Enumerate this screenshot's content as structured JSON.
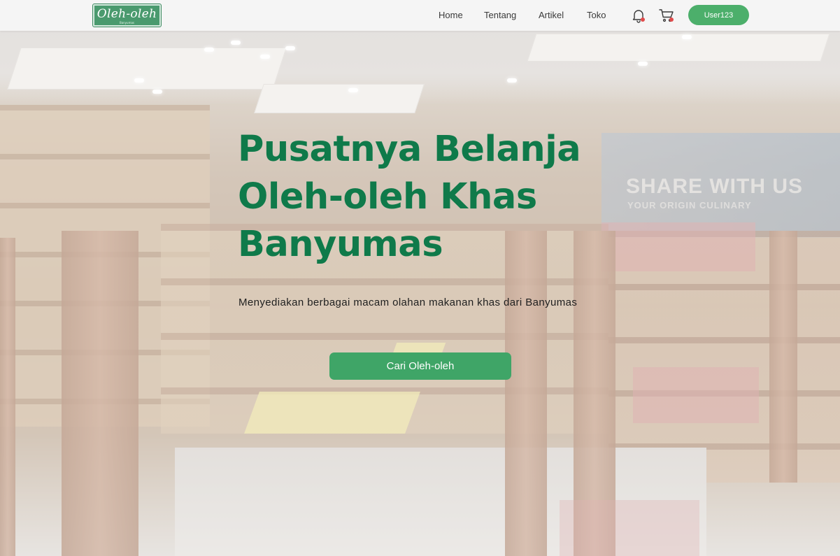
{
  "brand": {
    "logo_text": "Oleh-oleh",
    "logo_subtext": "Banyumas"
  },
  "nav": {
    "links": [
      {
        "label": "Home"
      },
      {
        "label": "Tentang"
      },
      {
        "label": "Artikel"
      },
      {
        "label": "Toko"
      }
    ],
    "notification_icon": "bell-icon",
    "cart_icon": "cart-icon",
    "user_label": "User123"
  },
  "hero": {
    "title_lines": [
      "Pusatnya Belanja",
      "Oleh-oleh Khas",
      "Banyumas"
    ],
    "description": "Menyediakan berbagai macam olahan makanan khas dari Banyumas",
    "cta_label": "Cari Oleh-oleh",
    "background_banner": {
      "line1": "SHARE WITH US",
      "line2": "YOUR ORIGIN CULINARY"
    }
  },
  "colors": {
    "brand_green": "#0f7a4a",
    "button_green": "#3fa567",
    "user_button_green": "#4caf6b",
    "badge_red": "#e04b4b"
  }
}
